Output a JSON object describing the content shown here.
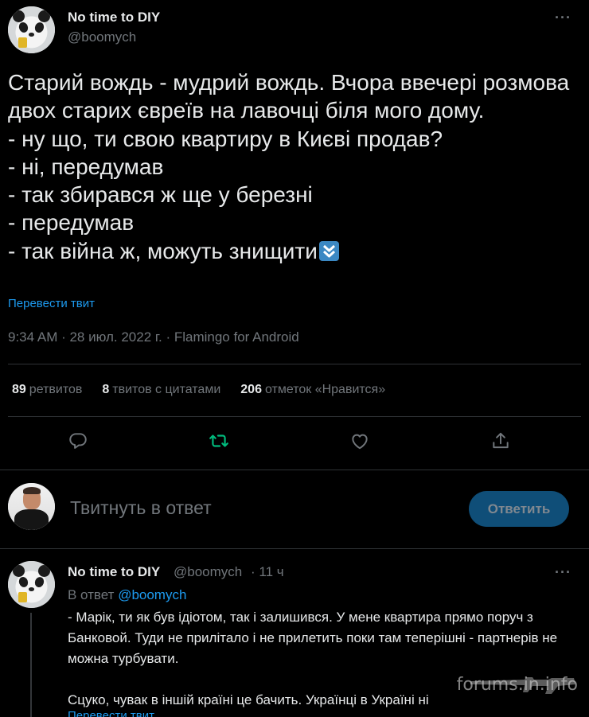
{
  "tweet": {
    "author_name": "No time to DIY",
    "author_handle": "@boomych",
    "text": "Старий вождь - мудрий вождь. Вчора ввечері розмова двох старих євреїв на лавочці біля мого дому.\n- ну що, ти свою квартиру в Києві продав?\n- ні, передумав\n- так збирався ж ще у березні\n- передумав\n- так війна ж, можуть знищити",
    "emoji": "double-down-arrow-emoji",
    "translate_label": "Перевести твит",
    "meta": "9:34 AM · 28 июл. 2022 г. · Flamingo for Android",
    "stats": {
      "retweets_count": "89",
      "retweets_label": "ретвитов",
      "quotes_count": "8",
      "quotes_label": "твитов с цитатами",
      "likes_count": "206",
      "likes_label": "отметок «Нравится»"
    }
  },
  "compose": {
    "placeholder": "Твитнуть в ответ",
    "button_label": "Ответить"
  },
  "reply": {
    "author_name": "No time to DIY",
    "author_handle": "@boomych",
    "time": "· 11 ч",
    "reply_to_prefix": "В ответ",
    "reply_to_handle": "@boomych",
    "text": "- Марік, ти як був ідіотом, так і залишився. У мене квартира прямо поруч з Банковой. Туди не прилітало і не прилетить поки там теперішні - партнерів не можна турбувати.\n\nСцуко, чувак в іншій країні це бачить. Українці в Україні ні",
    "translate_label": "Перевести твит"
  },
  "watermark": "forums.in.info",
  "colors": {
    "background": "#000000",
    "text": "#e7e9ea",
    "secondary": "#71767b",
    "accent": "#1d9bf0",
    "retweet_active": "#00ba7c",
    "reply_button": "#0f4e78"
  }
}
